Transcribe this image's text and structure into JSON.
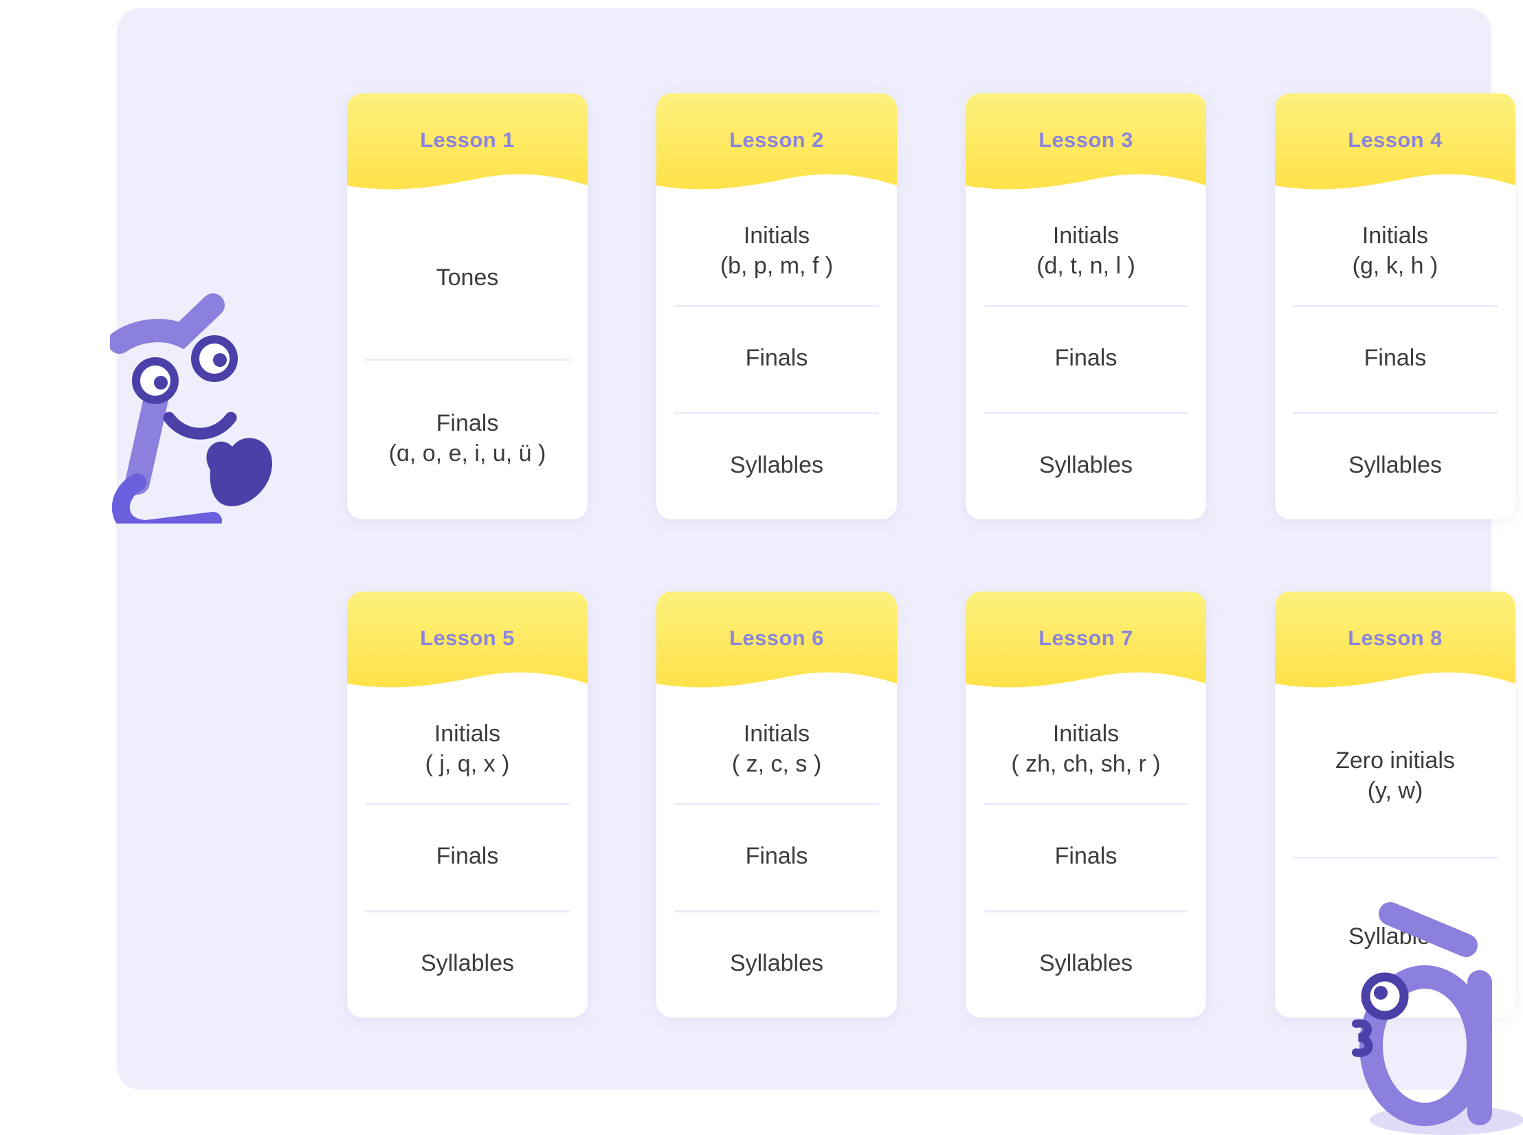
{
  "panel": {
    "background_color": "#EFEEFC",
    "card_background_color": "#FFFFFF",
    "header_gradient_top": "#FDF17E",
    "header_gradient_bottom": "#FFE249",
    "title_color": "#8B85DD",
    "body_text_color": "#3C3C3C",
    "divider_color": "#EDEBFA",
    "mascot_color": "#7E75D0",
    "mascot_dark_color": "#4B3FA8"
  },
  "cards": [
    {
      "title": "Lesson 1",
      "sections": [
        {
          "name": "tones",
          "lines": [
            "Tones"
          ]
        },
        {
          "name": "finals",
          "lines": [
            "Finals",
            "(ɑ, o, e, i, u, ü )"
          ]
        }
      ]
    },
    {
      "title": "Lesson 2",
      "sections": [
        {
          "name": "initials",
          "lines": [
            "Initials",
            "(b, p, m, f )"
          ]
        },
        {
          "name": "finals",
          "lines": [
            "Finals"
          ]
        },
        {
          "name": "syllables",
          "lines": [
            "Syllables"
          ]
        }
      ]
    },
    {
      "title": "Lesson 3",
      "sections": [
        {
          "name": "initials",
          "lines": [
            "Initials",
            "(d, t, n, l )"
          ]
        },
        {
          "name": "finals",
          "lines": [
            "Finals"
          ]
        },
        {
          "name": "syllables",
          "lines": [
            "Syllables"
          ]
        }
      ]
    },
    {
      "title": "Lesson 4",
      "sections": [
        {
          "name": "initials",
          "lines": [
            "Initials",
            "(g, k, h )"
          ]
        },
        {
          "name": "finals",
          "lines": [
            "Finals"
          ]
        },
        {
          "name": "syllables",
          "lines": [
            "Syllables"
          ]
        }
      ]
    },
    {
      "title": "Lesson 5",
      "sections": [
        {
          "name": "initials",
          "lines": [
            "Initials",
            "( j, q, x )"
          ]
        },
        {
          "name": "finals",
          "lines": [
            "Finals"
          ]
        },
        {
          "name": "syllables",
          "lines": [
            "Syllables"
          ]
        }
      ]
    },
    {
      "title": "Lesson 6",
      "sections": [
        {
          "name": "initials",
          "lines": [
            "Initials",
            "( z, c, s )"
          ]
        },
        {
          "name": "finals",
          "lines": [
            "Finals"
          ]
        },
        {
          "name": "syllables",
          "lines": [
            "Syllables"
          ]
        }
      ]
    },
    {
      "title": "Lesson 7",
      "sections": [
        {
          "name": "initials",
          "lines": [
            "Initials",
            "( zh, ch, sh, r )"
          ]
        },
        {
          "name": "finals",
          "lines": [
            "Finals"
          ]
        },
        {
          "name": "syllables",
          "lines": [
            "Syllables"
          ]
        }
      ]
    },
    {
      "title": "Lesson 8",
      "sections": [
        {
          "name": "zero-initials",
          "lines": [
            "Zero initials",
            "(y, w)"
          ]
        },
        {
          "name": "syllables",
          "lines": [
            "Syllables"
          ]
        }
      ]
    }
  ],
  "mascots": [
    {
      "name": "pinyin-letter-character-left",
      "description": "purple letter character with two eyes, smile and waving arms"
    },
    {
      "name": "pinyin-letter-a-character-right",
      "description": "purple lowercase a with tone mark and one eye"
    }
  ]
}
